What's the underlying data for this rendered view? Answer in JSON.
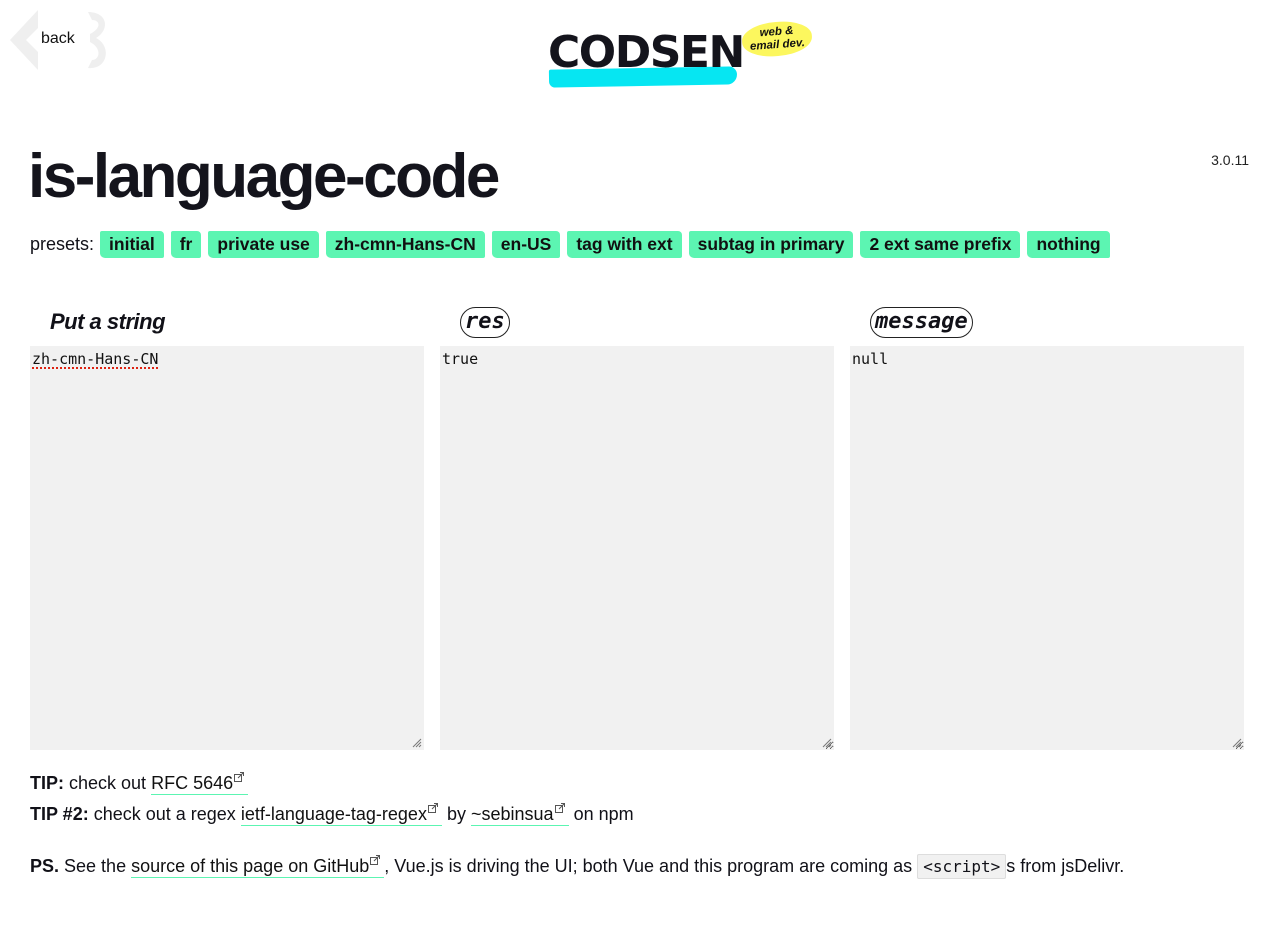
{
  "header": {
    "back_label": "back",
    "logo_text": "CODSEN",
    "logo_badge": [
      "web &",
      "email dev."
    ]
  },
  "version": "3.0.11",
  "title": "is-language-code",
  "presets": {
    "label": "presets:",
    "items": [
      "initial",
      "fr",
      "private use",
      "zh-cmn-Hans-CN",
      "en-US",
      "tag with ext",
      "subtag in primary",
      "2 ext same prefix",
      "nothing"
    ]
  },
  "columns": {
    "input": {
      "title": "Put a string",
      "value": "zh-cmn-Hans-CN"
    },
    "res": {
      "title": "res",
      "value": "true"
    },
    "message": {
      "title": "message",
      "value": "null"
    }
  },
  "tips": {
    "tip1": {
      "label": "TIP:",
      "text": "check out",
      "link": "RFC 5646"
    },
    "tip2": {
      "label": "TIP #2:",
      "text": "check out a regex",
      "link": "ietf-language-tag-regex",
      "by": "by",
      "author": "~sebinsua",
      "suffix": "on npm"
    },
    "ps": {
      "label": "PS.",
      "text1": "See the",
      "link": "source of this page on GitHub",
      "text2": ", Vue.js is driving the UI; both Vue and this program are coming as",
      "code": "<script>",
      "text3": "s from jsDelivr."
    }
  },
  "colors": {
    "accent": "#5cf5b2",
    "logo_underline": "#06e6f2",
    "badge": "#fcf75e",
    "box_bg": "#f1f1f1"
  }
}
